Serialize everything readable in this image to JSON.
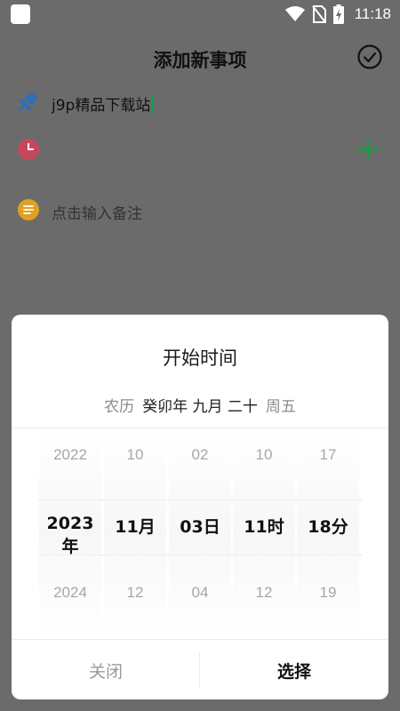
{
  "status_bar": {
    "time": "11:18",
    "icons": [
      "app-icon",
      "wifi-icon",
      "no-sim-icon",
      "battery-charging-icon"
    ]
  },
  "header": {
    "title": "添加新事项",
    "confirm_icon": "check-circle-icon"
  },
  "form": {
    "title_field": {
      "value": "j9p精品下载站",
      "icon": "pushpin-icon"
    },
    "time_row": {
      "icon": "clock-icon",
      "add_icon": "plus-icon"
    },
    "note_field": {
      "placeholder": "点击输入备注",
      "icon": "note-icon"
    }
  },
  "dialog": {
    "title": "开始时间",
    "lunar_label": "农历",
    "lunar_value": "癸卯年 九月 二十",
    "weekday": "周五",
    "columns": [
      {
        "prev": "2022",
        "selected": "2023年",
        "next": "2024"
      },
      {
        "prev": "10",
        "selected": "11月",
        "next": "12"
      },
      {
        "prev": "02",
        "selected": "03日",
        "next": "04"
      },
      {
        "prev": "10",
        "selected": "11时",
        "next": "12"
      },
      {
        "prev": "17",
        "selected": "18分",
        "next": "19"
      }
    ],
    "close_label": "关闭",
    "select_label": "选择"
  },
  "colors": {
    "overlay": "#6b6b6b",
    "accent_green": "#1a9a45",
    "pin_blue": "#2f6fb5",
    "clock_red": "#c8455e",
    "note_orange": "#e0a020"
  }
}
